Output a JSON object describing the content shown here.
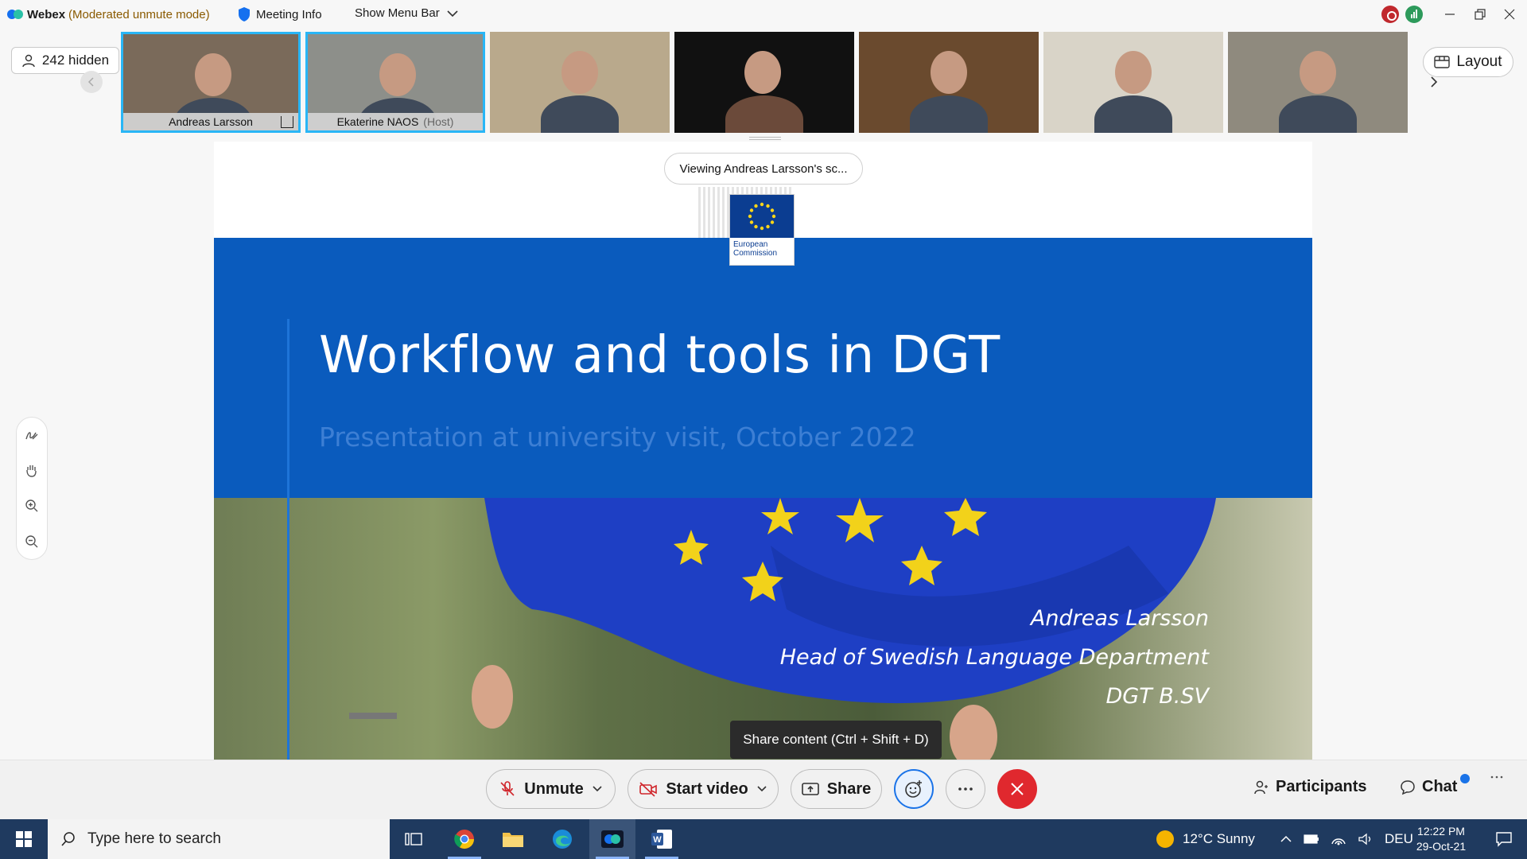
{
  "titlebar": {
    "app_name": "Webex",
    "mode": "(Moderated unmute mode)",
    "meeting_info": "Meeting Info",
    "show_menu_bar": "Show Menu Bar"
  },
  "participants_strip": {
    "hidden_count": "242 hidden",
    "tiles": [
      {
        "name": "Andreas Larsson",
        "role": "",
        "active": true,
        "bg": "#7a6a5a"
      },
      {
        "name": "Ekaterine NAOS",
        "role": "(Host)",
        "active": true,
        "bg": "#8d8f8a"
      },
      {
        "name": "",
        "role": "",
        "active": false,
        "bg": "#b9a98c"
      },
      {
        "name": "",
        "role": "",
        "active": false,
        "bg": "#111111"
      },
      {
        "name": "",
        "role": "",
        "active": false,
        "bg": "#6a4a2e"
      },
      {
        "name": "",
        "role": "",
        "active": false,
        "bg": "#d9d4c8"
      },
      {
        "name": "",
        "role": "",
        "active": false,
        "bg": "#8f8a7e"
      }
    ],
    "layout_label": "Layout"
  },
  "share": {
    "viewing_label": "Viewing Andreas Larsson's sc...",
    "tooltip": "Share content (Ctrl + Shift + D)"
  },
  "slide": {
    "logo_line1": "European",
    "logo_line2": "Commission",
    "title": "Workflow and tools in DGT",
    "subtitle": "Presentation at university visit, October 2022",
    "author_name": "Andreas Larsson",
    "author_role": "Head of Swedish Language Department",
    "author_unit": "DGT B.SV"
  },
  "side_tools": [
    "annotate-icon",
    "hand-icon",
    "zoom-in-icon",
    "zoom-out-icon"
  ],
  "controls": {
    "unmute": "Unmute",
    "start_video": "Start video",
    "share": "Share",
    "participants": "Participants",
    "chat": "Chat",
    "leave_color": "#e0282e"
  },
  "taskbar": {
    "search_placeholder": "Type here to search",
    "weather": "12°C  Sunny",
    "language": "DEU",
    "time": "12:22 PM",
    "date": "29-Oct-21"
  }
}
